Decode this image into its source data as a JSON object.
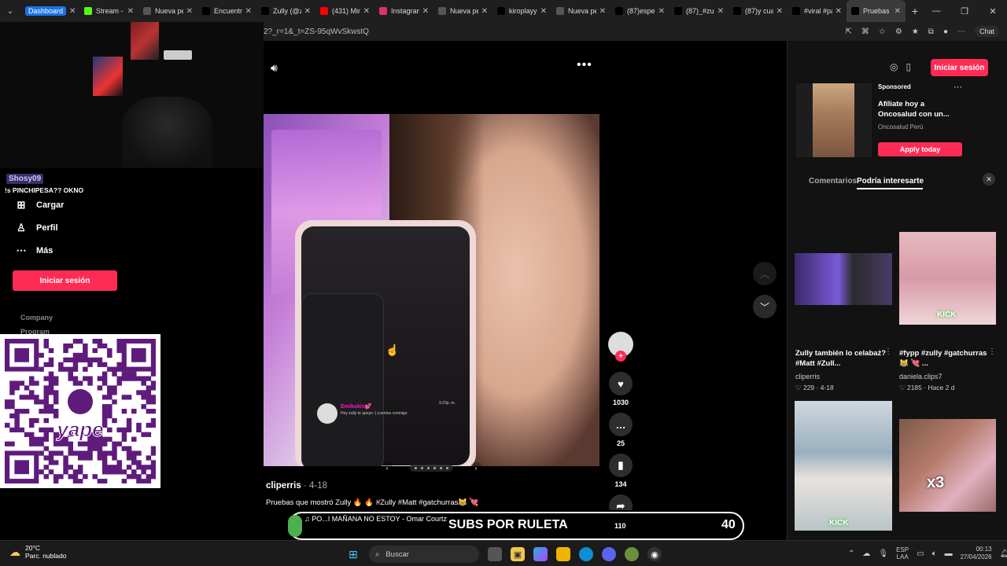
{
  "tabs": [
    {
      "title": "Dashboard",
      "color": "#1a73e8",
      "icon": "dashboard-icon"
    },
    {
      "title": "Stream - K",
      "color": "#53fc18",
      "icon": "kick-icon"
    },
    {
      "title": "Nueva pes",
      "color": "#555555",
      "icon": "blank-page-icon"
    },
    {
      "title": "Encuentra",
      "color": "#000000",
      "icon": "tiktok-icon"
    },
    {
      "title": "Zully (@z",
      "color": "#000000",
      "icon": "tiktok-icon"
    },
    {
      "title": "(431) Mine",
      "color": "#ff0000",
      "icon": "youtube-icon"
    },
    {
      "title": "Instagram",
      "color": "#e1306c",
      "icon": "instagram-icon"
    },
    {
      "title": "Nueva pes",
      "color": "#555555",
      "icon": "blank-page-icon"
    },
    {
      "title": "kiroplayy",
      "color": "#000000",
      "icon": "tiktok-icon"
    },
    {
      "title": "Nueva pes",
      "color": "#555555",
      "icon": "blank-page-icon"
    },
    {
      "title": "(87)esperi",
      "color": "#000000",
      "icon": "tiktok-icon"
    },
    {
      "title": "(87)_#zull",
      "color": "#000000",
      "icon": "tiktok-icon"
    },
    {
      "title": "(87)y cual",
      "color": "#000000",
      "icon": "tiktok-icon"
    },
    {
      "title": "#viral #pa",
      "color": "#000000",
      "icon": "tiktok-icon"
    },
    {
      "title": "Pruebas q",
      "color": "#000000",
      "icon": "tiktok-icon"
    }
  ],
  "address": {
    "url": "2?_r=1&_t=ZS-95qWvSkwstQ",
    "chat_label": "Chat"
  },
  "overlay": {
    "chat_user": "Shosy09",
    "chat_message": "!s PINCHIPESA?? OKNO"
  },
  "sidebar": {
    "items": [
      {
        "label": "Cargar",
        "icon": "upload-icon"
      },
      {
        "label": "Perfil",
        "icon": "profile-icon"
      },
      {
        "label": "Más",
        "icon": "more-icon"
      }
    ],
    "login_label": "Iniciar sesión",
    "company": "Company",
    "program": "Program"
  },
  "qr": {
    "brand": "yape",
    "brand_color": "#5f1b7c"
  },
  "video": {
    "author": "cliperris",
    "date": "· 4-18",
    "description": "Pruebas que mostró Zully 🔥 🔥 #Zully #Matt #gatchurras😹 💘",
    "music": "♫  PO...I MAÑANA NO ESTOY - Omar Courtz",
    "phone_name": "Emikukis💕",
    "phone_msg": "Hey zully te apoyo :) cuentas conmigo",
    "phone_time": "9:23p. m."
  },
  "actions": {
    "likes": "1030",
    "comments": "25",
    "saves": "134",
    "shares": "110"
  },
  "right_panel": {
    "login_label": "Iniciar sesión",
    "ad": {
      "sponsored": "Sponsored",
      "title": "Afíliate hoy a Oncosalud con un...",
      "brand": "Oncosalud Perú",
      "cta": "Apply today"
    },
    "tabs": [
      "Comentarios",
      "Podría interesarte"
    ],
    "videos": [
      {
        "title": "Zully también lo celabaż? #Matt #Zull...",
        "author": "cliperris",
        "stats": "♡ 229 · 4-18"
      },
      {
        "title": "#fypp #zully #gatchurras😹 💘 ...",
        "author": "daniela.clips7",
        "stats": "♡ 2185 · Hace 2 d"
      }
    ],
    "kick_label": "KICK",
    "x3_label": "x3"
  },
  "subs": {
    "label": "SUBS POR RULETA",
    "count": "40",
    "knob_label": "1"
  },
  "taskbar": {
    "temp": "20°C",
    "weather": "Parc. nublado",
    "search": "Buscar",
    "lang1": "ESP",
    "lang2": "LAA",
    "time": "00:13",
    "date": "27/04/2026"
  }
}
